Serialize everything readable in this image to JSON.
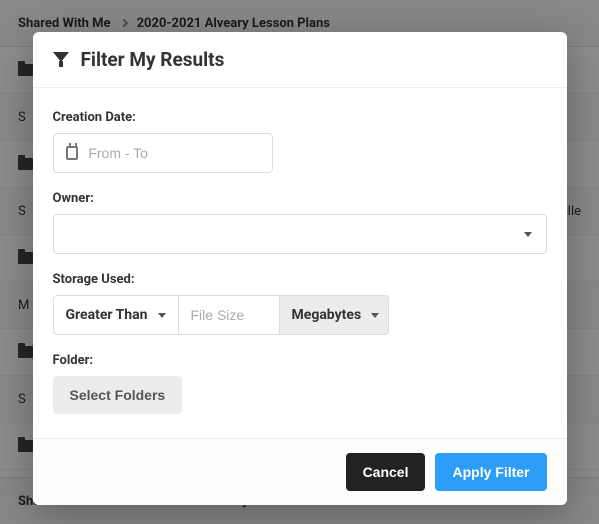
{
  "breadcrumb": {
    "root": "Shared With Me",
    "current": "2020-2021 Alveary Lesson Plans"
  },
  "list": {
    "visible_owner": "elle",
    "shared_label": "S",
    "more_label": "M"
  },
  "modal": {
    "title": "Filter My Results",
    "creation_date": {
      "label": "Creation Date:",
      "placeholder": "From - To",
      "value": ""
    },
    "owner": {
      "label": "Owner:",
      "value": ""
    },
    "storage": {
      "label": "Storage Used:",
      "comparator": "Greater Than",
      "file_size_placeholder": "File Size",
      "file_size_value": "",
      "unit": "Megabytes"
    },
    "folder": {
      "label": "Folder:",
      "button": "Select Folders"
    },
    "cancel": "Cancel",
    "apply": "Apply Filter"
  }
}
